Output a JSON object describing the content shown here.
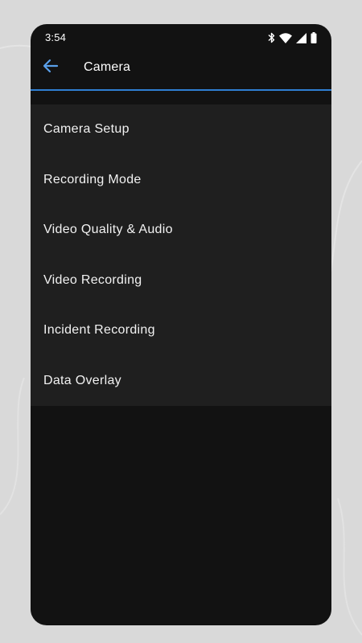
{
  "status_bar": {
    "time": "3:54",
    "icons": [
      "bluetooth-icon",
      "wifi-icon",
      "cell-signal-icon",
      "battery-icon"
    ]
  },
  "app_bar": {
    "title": "Camera",
    "back_icon": "arrow-back-icon"
  },
  "menu": {
    "items": [
      {
        "label": "Camera Setup"
      },
      {
        "label": "Recording Mode"
      },
      {
        "label": "Video Quality & Audio"
      },
      {
        "label": "Video Recording"
      },
      {
        "label": "Incident Recording"
      },
      {
        "label": "Data Overlay"
      }
    ]
  },
  "colors": {
    "background": "#121212",
    "list_surface": "#1f1f1f",
    "accent": "#2f7fd3",
    "back_arrow": "#5aa0ea",
    "text": "#f2f2f2",
    "page_backdrop": "#d9d9d9"
  }
}
